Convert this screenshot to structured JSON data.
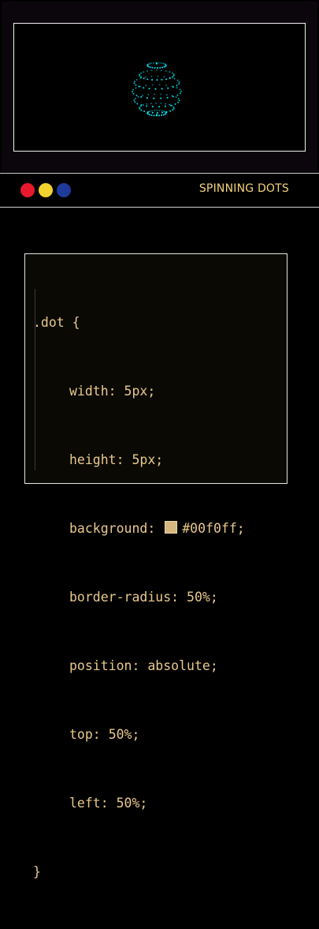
{
  "header": {
    "title": "SPINNING DOTS",
    "window_buttons": [
      {
        "name": "red",
        "color": "#e8192c"
      },
      {
        "name": "yellow",
        "color": "#f2d22e"
      },
      {
        "name": "blue",
        "color": "#1e3a9a"
      }
    ]
  },
  "preview": {
    "dot_color": "#00f0ff"
  },
  "code": {
    "selector": ".dot {",
    "lines": [
      {
        "property": "width:",
        "value": "5px;"
      },
      {
        "property": "height:",
        "value": "5px;"
      },
      {
        "property": "background:",
        "value": "#00f0ff;",
        "has_swatch": true
      },
      {
        "property": "border-radius:",
        "value": "50%;"
      },
      {
        "property": "position:",
        "value": "absolute;"
      },
      {
        "property": "top:",
        "value": "50%;"
      },
      {
        "property": "left:",
        "value": "50%;"
      }
    ],
    "closing": "}"
  }
}
